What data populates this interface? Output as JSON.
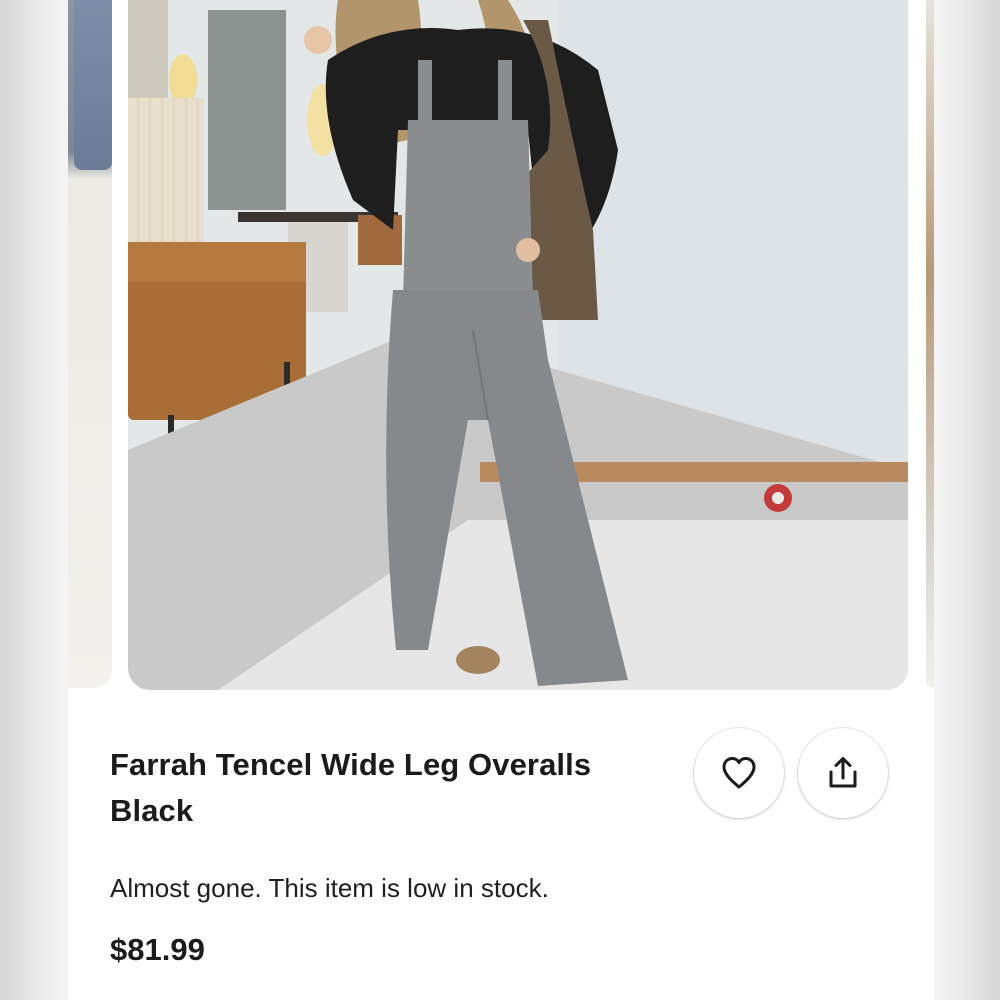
{
  "product": {
    "title": "Farrah Tencel Wide Leg Overalls Black",
    "stock_message": "Almost gone. This item is low in stock.",
    "price": "$81.99"
  },
  "actions": {
    "like_icon": "heart-icon",
    "share_icon": "share-icon"
  },
  "gallery": {
    "main_image": "product-photo-overalls",
    "image_count_visible": 3
  }
}
